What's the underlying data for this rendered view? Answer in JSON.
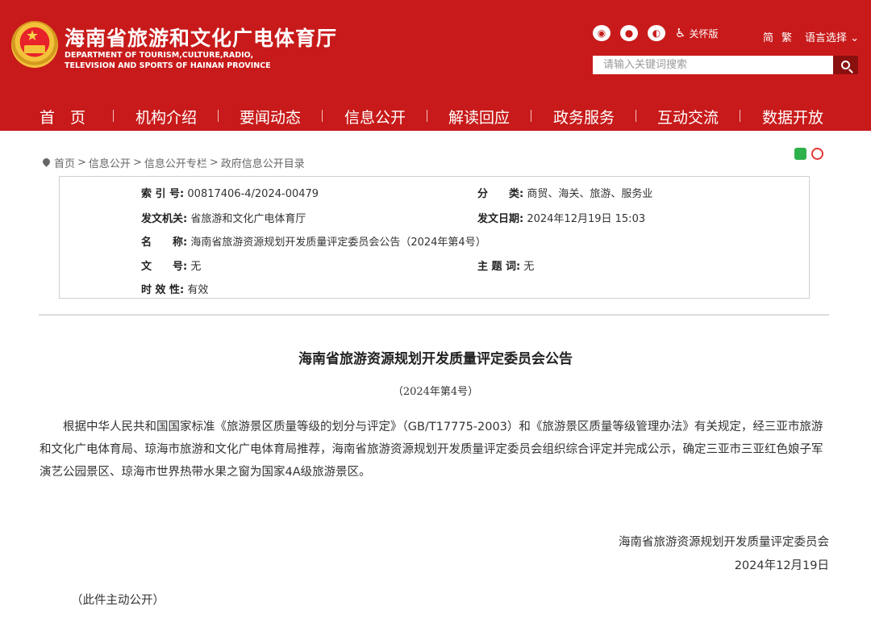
{
  "header": {
    "site_title": "海南省旅游和文化广电体育厅",
    "site_sub_line1": "DEPARTMENT OF TOURISM,CULTURE,RADIO,",
    "site_sub_line2": "TELEVISION AND SPORTS OF HAINAN PROVINCE",
    "care_mode": "关怀版",
    "lang_simplified": "简",
    "lang_traditional": "繁",
    "lang_select": "语言选择",
    "search_placeholder": "请输入关键词搜索",
    "brand_color": "#c81a1a"
  },
  "nav": [
    "首　页",
    "机构介绍",
    "要闻动态",
    "信息公开",
    "解读回应",
    "政务服务",
    "互动交流",
    "数据开放"
  ],
  "breadcrumb": [
    "首页",
    "信息公开",
    "信息公开专栏",
    "政府信息公开目录"
  ],
  "breadcrumb_sep": ">",
  "info": {
    "index_label": "索 引 号:",
    "index_value": "00817406-4/2024-00479",
    "category_label": "分　　类:",
    "category_value": "商贸、海关、旅游、服务业",
    "issuer_label": "发文机关:",
    "issuer_value": "省旅游和文化广电体育厅",
    "date_label": "发文日期:",
    "date_value": "2024年12月19日 15:03",
    "name_label": "名　　称:",
    "name_value": "海南省旅游资源规划开发质量评定委员会公告（2024年第4号）",
    "docno_label": "文　　号:",
    "docno_value": "无",
    "keyword_label": "主 题 词:",
    "keyword_value": "无",
    "validity_label": "时 效 性:",
    "validity_value": "有效"
  },
  "doc": {
    "title": "海南省旅游资源规划开发质量评定委员会公告",
    "number": "（2024年第4号）",
    "body": "根据中华人民共和国国家标准《旅游景区质量等级的划分与评定》（GB/T17775-2003）和《旅游景区质量等级管理办法》有关规定，经三亚市旅游和文化广电体育局、琼海市旅游和文化广电体育局推荐，海南省旅游资源规划开发质量评定委员会组织综合评定并完成公示，确定三亚市三亚红色娘子军演艺公园景区、琼海市世界热带水果之窗为国家4A级旅游景区。",
    "signer": "海南省旅游资源规划开发质量评定委员会",
    "sign_date": "2024年12月19日",
    "note": "（此件主动公开）"
  }
}
